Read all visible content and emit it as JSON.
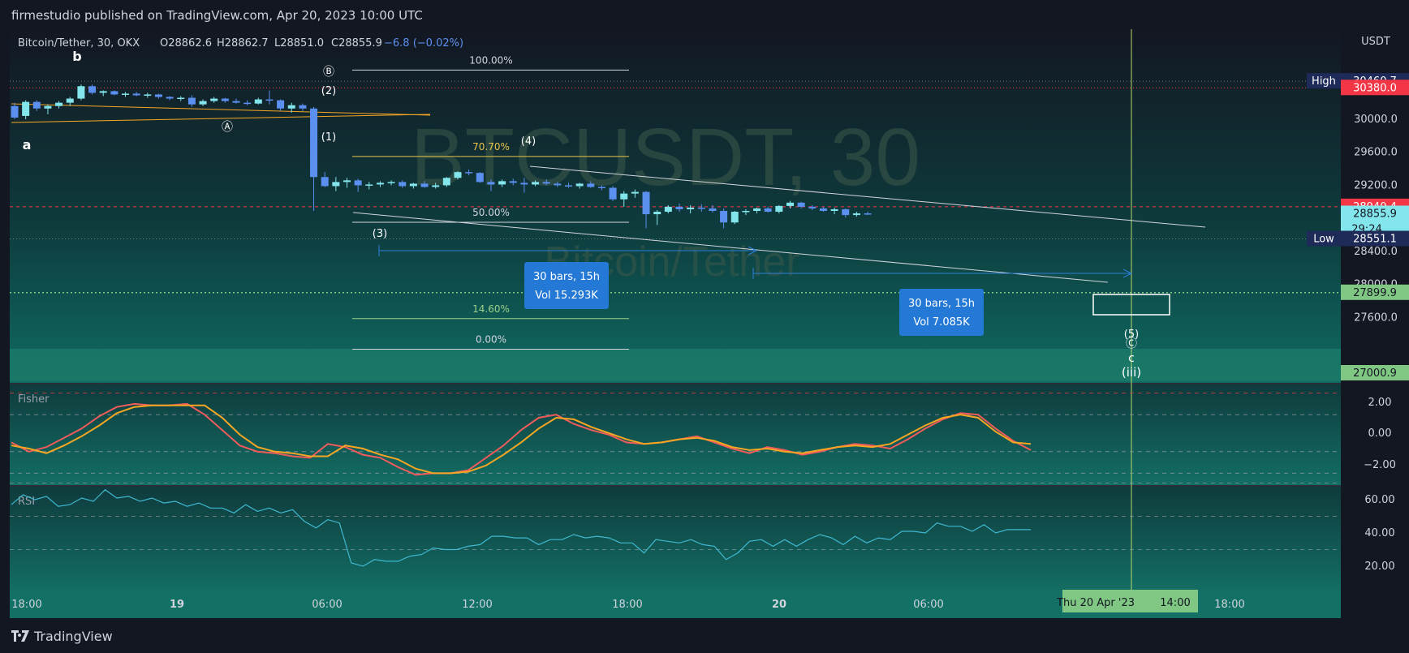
{
  "header": {
    "published_text": "firmestudio published on TradingView.com, Apr 20, 2023 10:00 UTC"
  },
  "legend": {
    "symbol": "Bitcoin/Tether, 30, OKX",
    "open": "O28862.6",
    "high": "H28862.7",
    "low": "L28851.0",
    "close": "C28855.9",
    "change": "−6.8 (−0.02%)"
  },
  "watermark": {
    "ticker": "BTCUSDT, 30",
    "name": "Bitcoin/Tether"
  },
  "footer": {
    "brand": "TradingView"
  },
  "colors": {
    "background_top": "#131722",
    "background_bottom": "#0f6b62",
    "bull": "#83e6ec",
    "bear": "#5b8ff0",
    "price_red": "#f23645",
    "price_green": "#81c784",
    "fisher_fast": "#f05b5b",
    "fisher_slow": "#f6a623",
    "rsi": "#3fb8d0",
    "blue_label": "#2478d6"
  },
  "chart_data": [
    {
      "type": "candlestick",
      "title": "Bitcoin/Tether, 30, OKX",
      "ylabel": "USDT",
      "ylim": [
        27000,
        30700
      ],
      "x_ticks": [
        "18:00",
        "19",
        "06:00",
        "12:00",
        "18:00",
        "20",
        "06:00",
        "14:00",
        "18:00"
      ],
      "x_tick_bold": [
        "19",
        "20"
      ],
      "cursor_date": "Thu 20 Apr '23",
      "cursor_time": "14:00",
      "y_ticks": [
        {
          "label": "30000.0",
          "value": 30000
        },
        {
          "label": "29600.0",
          "value": 29600
        },
        {
          "label": "29200.0",
          "value": 29200
        },
        {
          "label": "28400.0",
          "value": 28400
        },
        {
          "label": "28000.0",
          "value": 28000
        },
        {
          "label": "27600.0",
          "value": 27600
        }
      ],
      "price_tags": [
        {
          "label": "High",
          "value": "30460.7",
          "price": 30460.7,
          "style": "navy"
        },
        {
          "label": "",
          "value": "30380.0",
          "price": 30380,
          "style": "red"
        },
        {
          "label": "",
          "value": "28940.4",
          "price": 28940.4,
          "style": "red"
        },
        {
          "label": "",
          "value": "28855.9",
          "sub": "29:24",
          "price": 28855.9,
          "style": "cyan"
        },
        {
          "label": "Low",
          "value": "28551.1",
          "price": 28551.1,
          "style": "navy"
        },
        {
          "label": "",
          "value": "27899.9",
          "price": 27899.9,
          "style": "green"
        },
        {
          "label": "",
          "value": "27000.9",
          "price": 27000.9,
          "style": "green"
        }
      ],
      "candles": [
        [
          30160,
          30200,
          30000,
          30020
        ],
        [
          30040,
          30230,
          30000,
          30210
        ],
        [
          30210,
          30230,
          30100,
          30130
        ],
        [
          30130,
          30180,
          30060,
          30160
        ],
        [
          30160,
          30220,
          30130,
          30200
        ],
        [
          30200,
          30270,
          30160,
          30250
        ],
        [
          30250,
          30420,
          30230,
          30400
        ],
        [
          30400,
          30420,
          30300,
          30320
        ],
        [
          30320,
          30350,
          30280,
          30340
        ],
        [
          30340,
          30350,
          30290,
          30300
        ],
        [
          30300,
          30330,
          30270,
          30310
        ],
        [
          30310,
          30330,
          30280,
          30290
        ],
        [
          30290,
          30320,
          30260,
          30300
        ],
        [
          30300,
          30310,
          30250,
          30270
        ],
        [
          30270,
          30280,
          30230,
          30250
        ],
        [
          30250,
          30280,
          30220,
          30260
        ],
        [
          30260,
          30290,
          30150,
          30180
        ],
        [
          30180,
          30240,
          30160,
          30220
        ],
        [
          30220,
          30270,
          30200,
          30250
        ],
        [
          30250,
          30260,
          30200,
          30220
        ],
        [
          30220,
          30250,
          30190,
          30200
        ],
        [
          30200,
          30230,
          30170,
          30190
        ],
        [
          30190,
          30260,
          30180,
          30240
        ],
        [
          30240,
          30350,
          30180,
          30230
        ],
        [
          30230,
          30240,
          30100,
          30130
        ],
        [
          30130,
          30200,
          30080,
          30170
        ],
        [
          30170,
          30190,
          30100,
          30130
        ],
        [
          30130,
          30150,
          28890,
          29300
        ],
        [
          29300,
          29360,
          29180,
          29190
        ],
        [
          29190,
          29300,
          29130,
          29240
        ],
        [
          29240,
          29290,
          29170,
          29260
        ],
        [
          29260,
          29280,
          29120,
          29200
        ],
        [
          29200,
          29240,
          29150,
          29210
        ],
        [
          29210,
          29250,
          29180,
          29230
        ],
        [
          29230,
          29260,
          29200,
          29240
        ],
        [
          29240,
          29260,
          29170,
          29190
        ],
        [
          29190,
          29230,
          29160,
          29220
        ],
        [
          29220,
          29250,
          29170,
          29180
        ],
        [
          29180,
          29230,
          29160,
          29200
        ],
        [
          29200,
          29300,
          29180,
          29290
        ],
        [
          29290,
          29370,
          29270,
          29360
        ],
        [
          29360,
          29390,
          29320,
          29350
        ],
        [
          29350,
          29360,
          29230,
          29240
        ],
        [
          29240,
          29270,
          29130,
          29210
        ],
        [
          29210,
          29270,
          29180,
          29250
        ],
        [
          29250,
          29280,
          29200,
          29230
        ],
        [
          29230,
          29290,
          29110,
          29210
        ],
        [
          29210,
          29260,
          29190,
          29240
        ],
        [
          29240,
          29270,
          29200,
          29220
        ],
        [
          29220,
          29240,
          29180,
          29200
        ],
        [
          29200,
          29230,
          29170,
          29190
        ],
        [
          29190,
          29230,
          29160,
          29220
        ],
        [
          29220,
          29250,
          29170,
          29180
        ],
        [
          29180,
          29200,
          29140,
          29170
        ],
        [
          29170,
          29190,
          29010,
          29030
        ],
        [
          29030,
          29130,
          28940,
          29100
        ],
        [
          29100,
          29150,
          29050,
          29120
        ],
        [
          29120,
          29130,
          28680,
          28850
        ],
        [
          28850,
          28900,
          28720,
          28880
        ],
        [
          28880,
          28960,
          28860,
          28940
        ],
        [
          28940,
          28980,
          28880,
          28910
        ],
        [
          28910,
          28960,
          28860,
          28930
        ],
        [
          28930,
          28970,
          28880,
          28920
        ],
        [
          28920,
          28960,
          28870,
          28890
        ],
        [
          28890,
          28920,
          28680,
          28750
        ],
        [
          28750,
          28890,
          28730,
          28880
        ],
        [
          28880,
          28910,
          28840,
          28890
        ],
        [
          28890,
          28930,
          28860,
          28920
        ],
        [
          28920,
          28940,
          28870,
          28880
        ],
        [
          28880,
          28960,
          28860,
          28950
        ],
        [
          28950,
          29010,
          28920,
          28990
        ],
        [
          28990,
          29000,
          28920,
          28940
        ],
        [
          28940,
          28960,
          28900,
          28920
        ],
        [
          28920,
          28940,
          28880,
          28890
        ],
        [
          28890,
          28930,
          28850,
          28910
        ],
        [
          28910,
          28920,
          28810,
          28840
        ],
        [
          28840,
          28880,
          28820,
          28860
        ],
        [
          28860,
          28880,
          28840,
          28855.9
        ]
      ],
      "fib_levels": [
        {
          "label": "100.00%",
          "price": 30370,
          "color": "#d1d4dc"
        },
        {
          "label": "70.70%",
          "price": 29510,
          "color": "#e8c548"
        },
        {
          "label": "50.00%",
          "price": 28920,
          "color": "#d1d4dc"
        },
        {
          "label": "14.60%",
          "price": 27900,
          "color": "#9bd08a"
        },
        {
          "label": "0.00%",
          "price": 27480,
          "color": "#d1d4dc"
        }
      ],
      "measurements": [
        {
          "line1": "30 bars, 15h",
          "line2": "Vol 15.293K"
        },
        {
          "line1": "30 bars, 15h",
          "line2": "Vol 7.085K"
        }
      ],
      "wave_labels": [
        "b",
        "a",
        "Ⓑ",
        "(2)",
        "Ⓐ",
        "(1)",
        "(3)",
        "(4)",
        "(5)",
        "Ⓒ",
        "c",
        "(iii)"
      ]
    },
    {
      "type": "line",
      "title": "Fisher",
      "y_ticks": [
        "2.00",
        "0.00",
        "−2.00"
      ],
      "ylim": [
        -3.2,
        3.2
      ],
      "series": [
        {
          "name": "",
          "color": "#f05b5b",
          "values": [
            -0.6,
            -1.2,
            -0.9,
            -0.3,
            0.3,
            1.1,
            1.7,
            1.9,
            1.8,
            1.8,
            1.9,
            1.2,
            0.2,
            -0.8,
            -1.2,
            -1.3,
            -1.5,
            -1.6,
            -0.7,
            -0.9,
            -1.4,
            -1.6,
            -2.2,
            -2.7,
            -2.6,
            -2.6,
            -2.4,
            -1.6,
            -0.8,
            0.2,
            1.0,
            1.2,
            0.6,
            0.2,
            -0.1,
            -0.6,
            -0.7,
            -0.6,
            -0.4,
            -0.2,
            -0.6,
            -1.0,
            -1.3,
            -0.9,
            -1.1,
            -1.4,
            -1.2,
            -0.9,
            -0.7,
            -0.8,
            -1.0,
            -0.4,
            0.3,
            0.9,
            1.3,
            1.2,
            0.3,
            -0.5,
            -1.1
          ]
        },
        {
          "name": "",
          "color": "#f6a623",
          "values": [
            -0.8,
            -1.0,
            -1.3,
            -0.8,
            -0.2,
            0.5,
            1.3,
            1.7,
            1.8,
            1.8,
            1.8,
            1.8,
            1.0,
            -0.1,
            -0.9,
            -1.2,
            -1.3,
            -1.5,
            -1.5,
            -0.8,
            -1.0,
            -1.4,
            -1.7,
            -2.3,
            -2.6,
            -2.6,
            -2.5,
            -2.1,
            -1.4,
            -0.6,
            0.3,
            1.0,
            0.9,
            0.4,
            0.0,
            -0.4,
            -0.7,
            -0.6,
            -0.4,
            -0.3,
            -0.5,
            -0.9,
            -1.1,
            -1.0,
            -1.2,
            -1.3,
            -1.1,
            -0.9,
            -0.8,
            -0.9,
            -0.7,
            -0.1,
            0.5,
            1.0,
            1.2,
            1.0,
            0.1,
            -0.6,
            -0.7
          ]
        }
      ]
    },
    {
      "type": "line",
      "title": "RSI",
      "y_ticks": [
        "60.00",
        "40.00",
        "20.00"
      ],
      "ylim": [
        15,
        72
      ],
      "series": [
        {
          "name": "",
          "color": "#3fb8d0",
          "values": [
            57,
            63,
            60,
            62,
            56,
            57,
            61,
            59,
            66,
            61,
            62,
            59,
            61,
            58,
            59,
            56,
            58,
            55,
            55,
            52,
            57,
            53,
            55,
            52,
            54,
            47,
            43,
            48,
            46,
            22,
            20,
            24,
            23,
            23,
            26,
            27,
            31,
            30,
            30,
            32,
            33,
            38,
            38,
            37,
            37,
            33,
            36,
            36,
            39,
            37,
            38,
            37,
            34,
            34,
            28,
            36,
            35,
            34,
            36,
            33,
            32,
            24,
            28,
            35,
            36,
            32,
            36,
            32,
            36,
            39,
            37,
            33,
            38,
            34,
            37,
            36,
            41,
            41,
            40,
            46,
            44,
            44,
            41,
            45,
            40,
            42,
            42,
            42
          ]
        }
      ]
    }
  ]
}
